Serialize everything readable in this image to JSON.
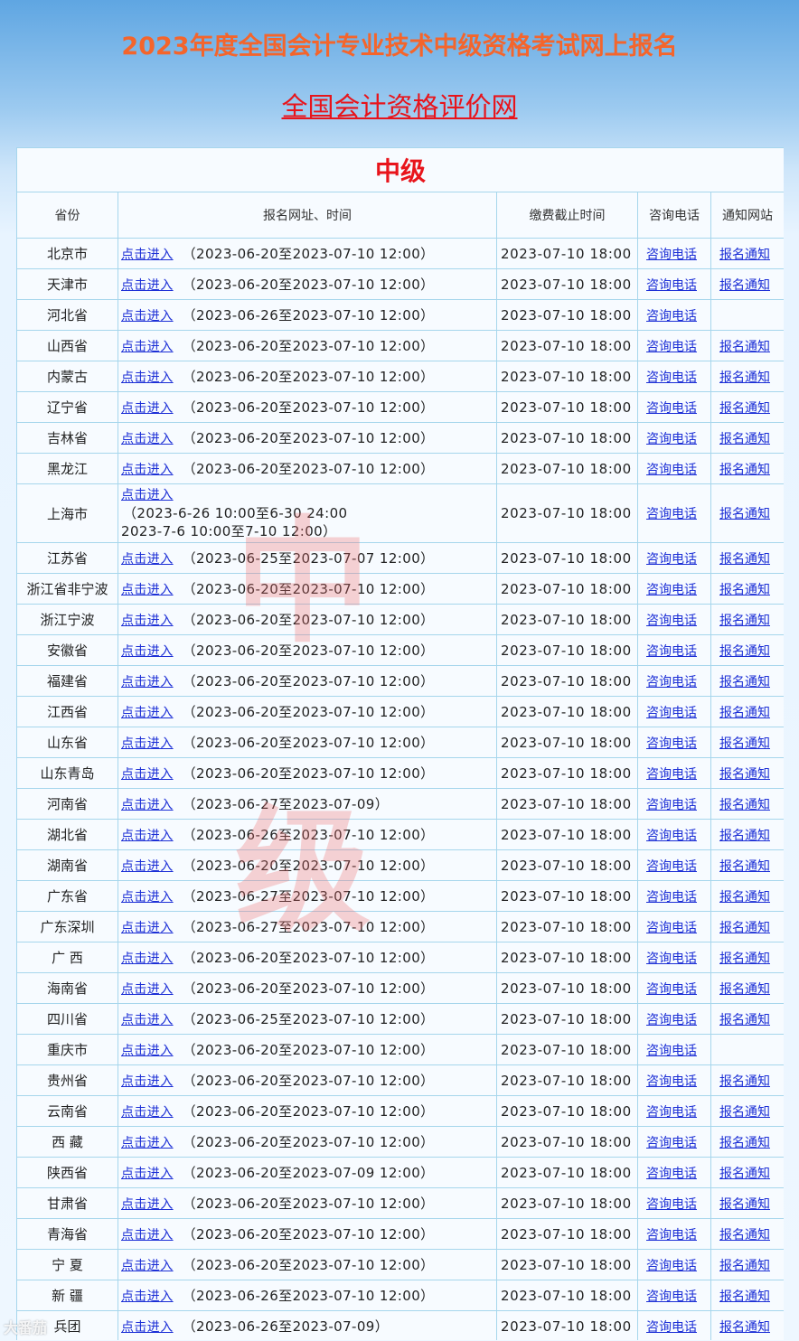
{
  "header": {
    "title": "2023年度全国会计专业技术中级资格考试网上报名",
    "site_link": "全国会计资格评价网"
  },
  "watermark": [
    "中",
    "级"
  ],
  "table": {
    "caption": "中级",
    "columns": [
      "省份",
      "报名网址、时间",
      "缴费截止时间",
      "咨询电话",
      "通知网站"
    ],
    "link_label": "点击进入",
    "tel_label": "咨询电话",
    "notice_label": "报名通知",
    "rows": [
      {
        "province": "北京市",
        "period": "（2023-06-20至2023-07-10 12:00）",
        "fee": "2023-07-10 18:00",
        "notice": "报名通知"
      },
      {
        "province": "天津市",
        "period": "（2023-06-20至2023-07-10 12:00）",
        "fee": "2023-07-10 18:00",
        "notice": "报名通知"
      },
      {
        "province": "河北省",
        "period": "（2023-06-26至2023-07-10 12:00）",
        "fee": "2023-07-10 18:00",
        "notice": ""
      },
      {
        "province": "山西省",
        "period": "（2023-06-20至2023-07-10 12:00）",
        "fee": "2023-07-10 18:00",
        "notice": "报名通知"
      },
      {
        "province": "内蒙古",
        "period": "（2023-06-20至2023-07-10 12:00）",
        "fee": "2023-07-10 18:00",
        "notice": "报名通知"
      },
      {
        "province": "辽宁省",
        "period": "（2023-06-20至2023-07-10 12:00）",
        "fee": "2023-07-10 18:00",
        "notice": "报名通知"
      },
      {
        "province": "吉林省",
        "period": "（2023-06-20至2023-07-10 12:00）",
        "fee": "2023-07-10 18:00",
        "notice": "报名通知"
      },
      {
        "province": "黑龙江",
        "period": "（2023-06-20至2023-07-10 12:00）",
        "fee": "2023-07-10 18:00",
        "notice": "报名通知"
      },
      {
        "province": "上海市",
        "period_lines": [
          "（2023-6-26 10:00至6-30 24:00",
          "2023-7-6 10:00至7-10 12:00）"
        ],
        "fee": "2023-07-10 18:00",
        "notice": "报名通知"
      },
      {
        "province": "江苏省",
        "period": "（2023-06-25至2023-07-07 12:00）",
        "fee": "2023-07-10 18:00",
        "notice": "报名通知"
      },
      {
        "province": "浙江省非宁波",
        "period": "（2023-06-20至2023-07-10 12:00）",
        "fee": "2023-07-10 18:00",
        "notice": "报名通知"
      },
      {
        "province": "浙江宁波",
        "period": "（2023-06-20至2023-07-10 12:00）",
        "fee": "2023-07-10 18:00",
        "notice": "报名通知"
      },
      {
        "province": "安徽省",
        "period": "（2023-06-20至2023-07-10 12:00）",
        "fee": "2023-07-10 18:00",
        "notice": "报名通知"
      },
      {
        "province": "福建省",
        "period": "（2023-06-20至2023-07-10 12:00）",
        "fee": "2023-07-10 18:00",
        "notice": "报名通知"
      },
      {
        "province": "江西省",
        "period": "（2023-06-20至2023-07-10 12:00）",
        "fee": "2023-07-10 18:00",
        "notice": "报名通知"
      },
      {
        "province": "山东省",
        "period": "（2023-06-20至2023-07-10 12:00）",
        "fee": "2023-07-10 18:00",
        "notice": "报名通知"
      },
      {
        "province": "山东青岛",
        "period": "（2023-06-20至2023-07-10 12:00）",
        "fee": "2023-07-10 18:00",
        "notice": "报名通知"
      },
      {
        "province": "河南省",
        "period": "（2023-06-27至2023-07-09）",
        "fee": "2023-07-10 18:00",
        "notice": "报名通知"
      },
      {
        "province": "湖北省",
        "period": "（2023-06-26至2023-07-10 12:00）",
        "fee": "2023-07-10 18:00",
        "notice": "报名通知"
      },
      {
        "province": "湖南省",
        "period": "（2023-06-20至2023-07-10 12:00）",
        "fee": "2023-07-10 18:00",
        "notice": "报名通知"
      },
      {
        "province": "广东省",
        "period": "（2023-06-27至2023-07-10 12:00）",
        "fee": "2023-07-10 18:00",
        "notice": "报名通知"
      },
      {
        "province": "广东深圳",
        "period": "（2023-06-27至2023-07-10 12:00）",
        "fee": "2023-07-10 18:00",
        "notice": "报名通知"
      },
      {
        "province": "广 西",
        "period": "（2023-06-20至2023-07-10 12:00）",
        "fee": "2023-07-10 18:00",
        "notice": "报名通知"
      },
      {
        "province": "海南省",
        "period": "（2023-06-20至2023-07-10 12:00）",
        "fee": "2023-07-10 18:00",
        "notice": "报名通知"
      },
      {
        "province": "四川省",
        "period": "（2023-06-25至2023-07-10 12:00）",
        "fee": "2023-07-10 18:00",
        "notice": "报名通知"
      },
      {
        "province": "重庆市",
        "period": "（2023-06-20至2023-07-10 12:00）",
        "fee": "2023-07-10 18:00",
        "notice": ""
      },
      {
        "province": "贵州省",
        "period": "（2023-06-20至2023-07-10 12:00）",
        "fee": "2023-07-10 18:00",
        "notice": "报名通知"
      },
      {
        "province": "云南省",
        "period": "（2023-06-20至2023-07-10 12:00）",
        "fee": "2023-07-10 18:00",
        "notice": "报名通知"
      },
      {
        "province": "西 藏",
        "period": "（2023-06-20至2023-07-10 12:00）",
        "fee": "2023-07-10 18:00",
        "notice": "报名通知"
      },
      {
        "province": "陕西省",
        "period": "（2023-06-20至2023-07-09 12:00）",
        "fee": "2023-07-10 18:00",
        "notice": "报名通知"
      },
      {
        "province": "甘肃省",
        "period": "（2023-06-20至2023-07-10 12:00）",
        "fee": "2023-07-10 18:00",
        "notice": "报名通知"
      },
      {
        "province": "青海省",
        "period": "（2023-06-20至2023-07-10 12:00）",
        "fee": "2023-07-10 18:00",
        "notice": "报名通知"
      },
      {
        "province": "宁 夏",
        "period": "（2023-06-20至2023-07-10 12:00）",
        "fee": "2023-07-10 18:00",
        "notice": "报名通知"
      },
      {
        "province": "新 疆",
        "period": "（2023-06-26至2023-07-10 12:00）",
        "fee": "2023-07-10 18:00",
        "notice": "报名通知"
      },
      {
        "province": "兵团",
        "period": "（2023-06-26至2023-07-09）",
        "fee": "2023-07-10 18:00",
        "notice": "报名通知"
      }
    ]
  },
  "corner_logo": "大番茄"
}
